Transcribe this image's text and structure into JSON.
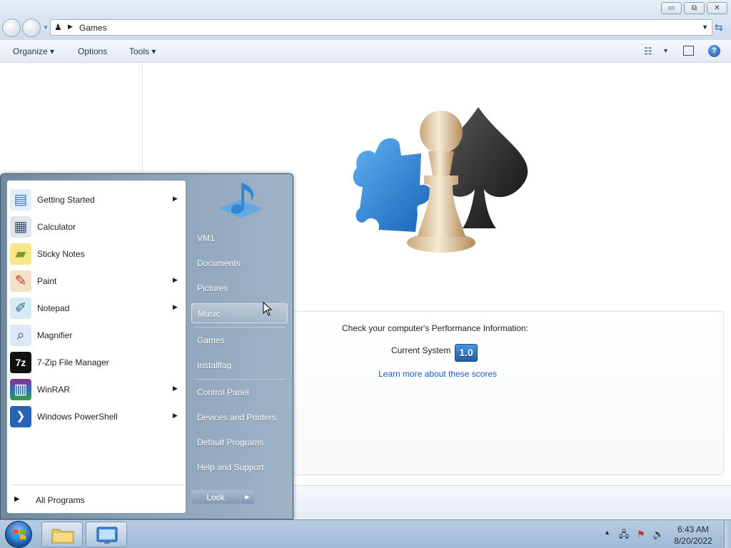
{
  "window": {
    "address": "Games",
    "controls": {
      "minimize": "▭",
      "maximize": "⧉",
      "close": "✕"
    }
  },
  "toolbar": {
    "organize": "Organize ▾",
    "options": "Options",
    "tools": "Tools ▾",
    "help": "?"
  },
  "performance": {
    "title": "Check your computer's Performance Information:",
    "system_label": "Current System",
    "score": "1.0",
    "link": "Learn more about these scores"
  },
  "start_menu": {
    "programs": [
      {
        "label": "Getting Started",
        "icon": "getting-started-icon",
        "has_submenu": true
      },
      {
        "label": "Calculator",
        "icon": "calculator-icon",
        "has_submenu": false
      },
      {
        "label": "Sticky Notes",
        "icon": "sticky-notes-icon",
        "has_submenu": false
      },
      {
        "label": "Paint",
        "icon": "paint-icon",
        "has_submenu": true
      },
      {
        "label": "Notepad",
        "icon": "notepad-icon",
        "has_submenu": true
      },
      {
        "label": "Magnifier",
        "icon": "magnifier-icon",
        "has_submenu": false
      },
      {
        "label": "7-Zip File Manager",
        "icon": "7zip-icon",
        "has_submenu": false
      },
      {
        "label": "WinRAR",
        "icon": "winrar-icon",
        "has_submenu": true
      },
      {
        "label": "Windows PowerShell",
        "icon": "powershell-icon",
        "has_submenu": true
      }
    ],
    "all_programs": "All Programs",
    "places": [
      {
        "label": "VM1"
      },
      {
        "label": "Documents"
      },
      {
        "label": "Pictures"
      },
      {
        "label": "Music",
        "highlighted": true
      },
      {
        "label": "Games"
      },
      {
        "label": "Installfag"
      },
      {
        "label": "Control Panel"
      },
      {
        "label": "Devices and Printers"
      },
      {
        "label": "Default Programs"
      },
      {
        "label": "Help and Support"
      }
    ],
    "lock": "Lock"
  },
  "taskbar": {
    "time": "6:43 AM",
    "date": "8/20/2022",
    "colors": {
      "accent": "#1b5ea8",
      "link": "#1a5fb4"
    }
  }
}
